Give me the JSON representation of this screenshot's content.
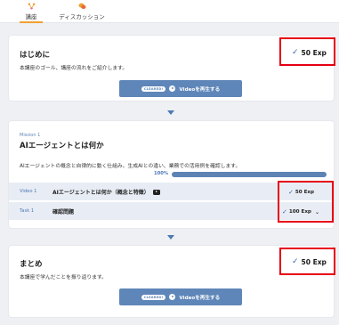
{
  "tabs": [
    {
      "label": "講座",
      "icon": "course-icon",
      "active": true
    },
    {
      "label": "ディスカッション",
      "icon": "discussion-icon",
      "active": false
    }
  ],
  "intro": {
    "title": "はじめに",
    "description": "本講座のゴール、講座の流れをご紹介します。",
    "exp": "50 Exp",
    "button_badge": "CLEARED!",
    "button_label": "Videoを再生する"
  },
  "mission": {
    "label": "Mission 1",
    "title": "AIエージェントとは何か",
    "description": "AIエージェントの概念と自律的に動く仕組み、生成AIとの違い、業務での活用例を確認します。",
    "progress_label": "100%",
    "progress": 1.0,
    "items": [
      {
        "type": "Video 1",
        "title": "AIエージェントとは何か（概念と特徴）",
        "exp": "50 Exp",
        "icon": "youtube-icon"
      },
      {
        "type": "Task 1",
        "title": "確認問題",
        "exp": "100 Exp",
        "icon": "chevron-down-icon"
      }
    ]
  },
  "summary": {
    "title": "まとめ",
    "description": "本講座で学んだことを振り返ります。",
    "exp": "50 Exp",
    "button_badge": "CLEARED!",
    "button_label": "Videoを再生する"
  },
  "colors": {
    "accent": "#5f86b9",
    "highlight": "#e60012",
    "tab_active": "#f0a030",
    "background": "#eef0f4"
  }
}
